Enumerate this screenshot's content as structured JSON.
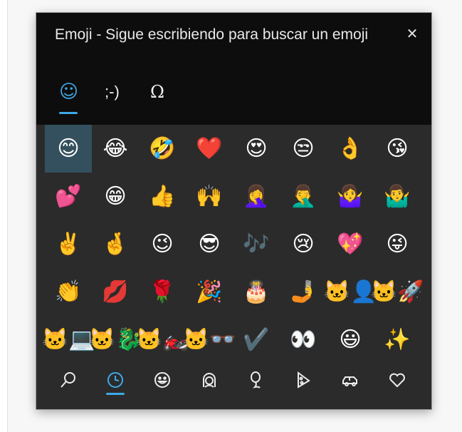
{
  "header": {
    "title": "Emoji - Sigue escribiendo para buscar un emoji",
    "close_label": "✕"
  },
  "tabs": [
    {
      "id": "emoji",
      "glyph": "☺",
      "active": true
    },
    {
      "id": "kaomoji",
      "glyph": ";-)",
      "active": false
    },
    {
      "id": "symbols",
      "glyph": "Ω",
      "active": false
    }
  ],
  "emoji_grid": [
    [
      "😊",
      "😂",
      "🤣",
      "❤️",
      "😍",
      "😒",
      "👌",
      "😘"
    ],
    [
      "💕",
      "😁",
      "👍",
      "🙌",
      "🤦‍♀️",
      "🤦‍♂️",
      "🤷‍♀️",
      "🤷‍♂️"
    ],
    [
      "✌️",
      "🤞",
      "😉",
      "😎",
      "🎶",
      "😢",
      "💖",
      "😜"
    ],
    [
      "👏",
      "💋",
      "🌹",
      "🎉",
      "🎂",
      "🤳",
      "🐱‍👤",
      "🐱‍🚀"
    ],
    [
      "🐱‍💻",
      "🐱‍🐉",
      "🐱‍🏍",
      "🐱‍👓",
      "✔️",
      "👀",
      "😃",
      "✨"
    ]
  ],
  "selected_cell": {
    "row": 0,
    "col": 0
  },
  "categories": [
    {
      "id": "search",
      "icon": "search-icon",
      "active": false
    },
    {
      "id": "recent",
      "icon": "clock-icon",
      "active": true
    },
    {
      "id": "smileys",
      "icon": "smiley-icon",
      "active": false
    },
    {
      "id": "people",
      "icon": "person-icon",
      "active": false
    },
    {
      "id": "celebrations",
      "icon": "balloon-icon",
      "active": false
    },
    {
      "id": "food",
      "icon": "pizza-icon",
      "active": false
    },
    {
      "id": "travel",
      "icon": "car-icon",
      "active": false
    },
    {
      "id": "symbols",
      "icon": "heart-icon",
      "active": false
    }
  ],
  "colors": {
    "accent": "#3fa9e6",
    "header_bg": "#0d0d0d",
    "panel_bg": "#2b2b2b",
    "selected_bg": "#34505e"
  }
}
